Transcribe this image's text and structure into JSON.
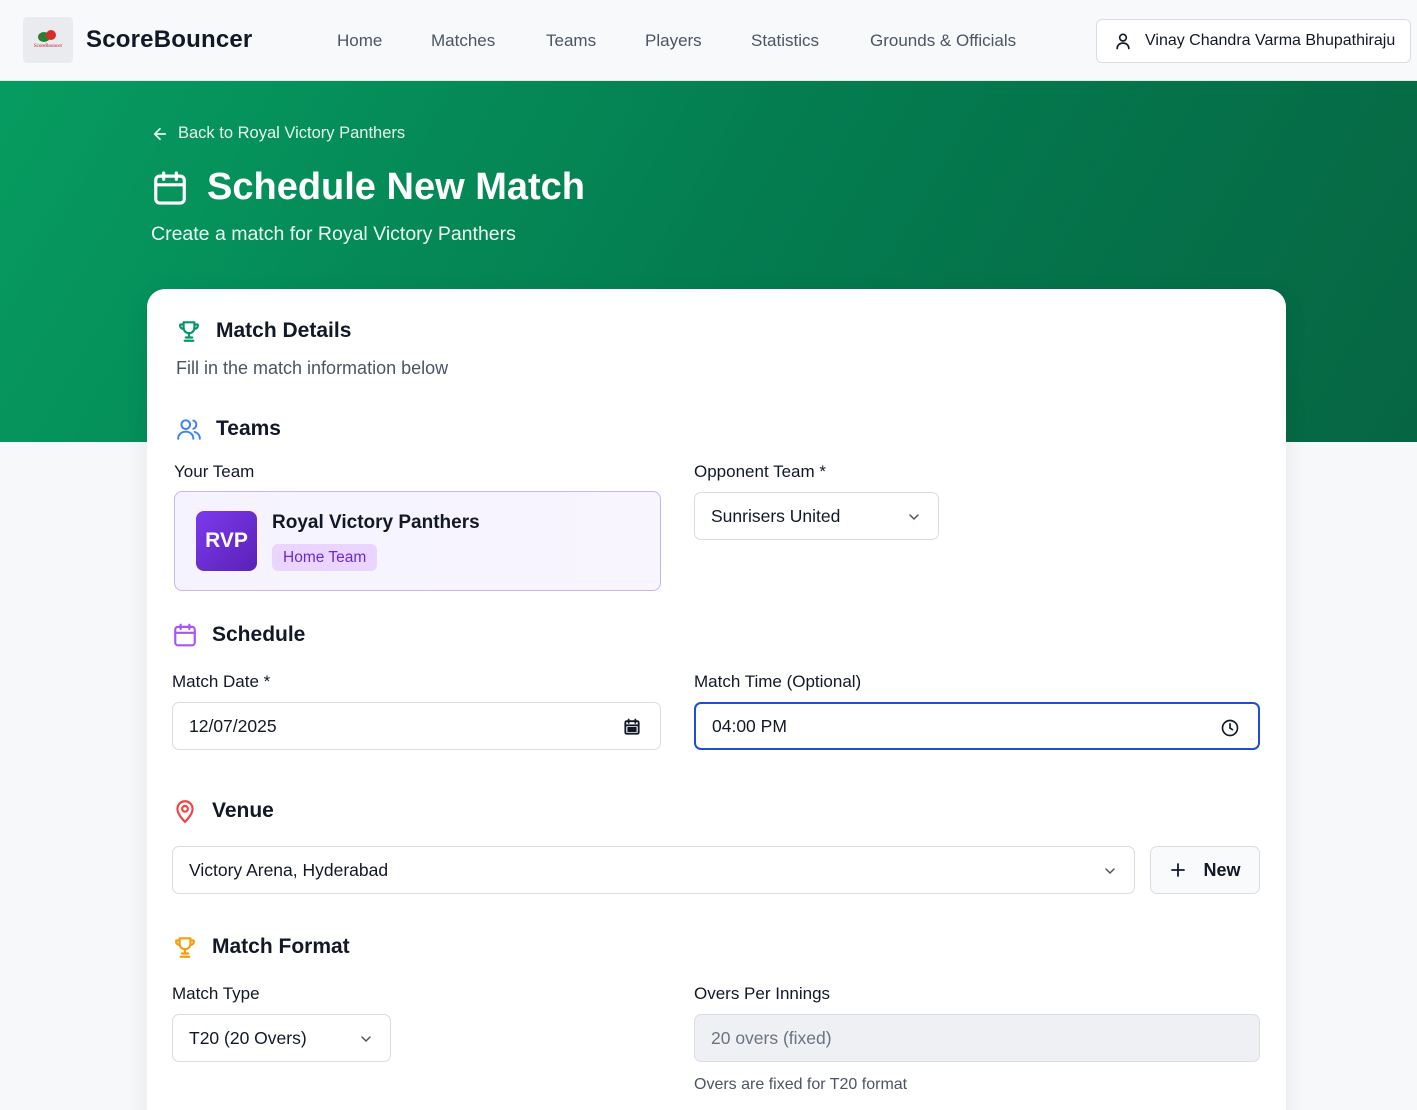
{
  "app": {
    "brand": "ScoreBouncer",
    "logo_text": "ScoreBouncer"
  },
  "nav": {
    "links": [
      "Home",
      "Matches",
      "Teams",
      "Players",
      "Statistics",
      "Grounds & Officials"
    ],
    "user_name": "Vinay Chandra Varma Bhupathiraju"
  },
  "hero": {
    "back_link": "Back to Royal Victory Panthers",
    "title": "Schedule New Match",
    "subtitle": "Create a match for Royal Victory Panthers"
  },
  "form": {
    "card_title": "Match Details",
    "card_desc": "Fill in the match information below",
    "teams": {
      "heading": "Teams",
      "your_team_label": "Your Team",
      "team_initials": "RVP",
      "team_name": "Royal Victory Panthers",
      "team_badge": "Home Team",
      "opponent_label": "Opponent Team *",
      "opponent_value": "Sunrisers United"
    },
    "schedule": {
      "heading": "Schedule",
      "date_label": "Match Date *",
      "date_value": "12/07/2025",
      "time_label": "Match Time (Optional)",
      "time_value": "04:00 PM"
    },
    "venue": {
      "heading": "Venue",
      "value": "Victory Arena, Hyderabad",
      "new_button": "New"
    },
    "format": {
      "heading": "Match Format",
      "type_label": "Match Type",
      "type_value": "T20 (20 Overs)",
      "overs_label": "Overs Per Innings",
      "overs_value": "20 overs (fixed)",
      "overs_helper": "Overs are fixed for T20 format"
    }
  },
  "colors": {
    "hero_green": "#069c60",
    "accent_purple": "#7c3aed",
    "focus_blue": "#1d4ed8",
    "venue_red": "#ef4444",
    "format_orange": "#f59e0b",
    "teams_blue": "#3b82f6"
  },
  "icons": {
    "user": "user-icon",
    "back": "arrow-left-icon",
    "title": "calendar-icon",
    "match_details": "trophy-icon",
    "teams": "users-icon",
    "schedule": "calendar-icon",
    "date_field": "calendar-icon",
    "time_field": "clock-icon",
    "venue": "map-pin-icon",
    "new": "plus-icon",
    "format": "trophy-icon",
    "dropdown": "chevron-down-icon"
  }
}
